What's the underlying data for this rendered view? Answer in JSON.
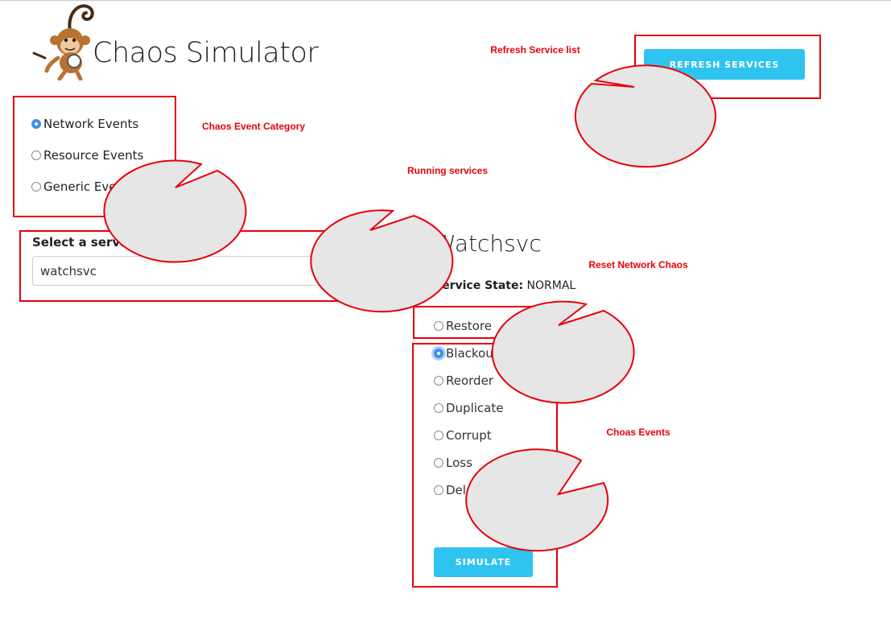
{
  "header": {
    "title": "Chaos Simulator"
  },
  "logo": {
    "icon": "monkey-logo-icon"
  },
  "refresh_button": {
    "label": "REFRESH SERVICES"
  },
  "categories": [
    {
      "label": "Network Events",
      "checked": true
    },
    {
      "label": "Resource Events",
      "checked": false
    },
    {
      "label": "Generic Events",
      "checked": false
    }
  ],
  "service_select": {
    "label": "Select a service",
    "value": "watchsvc"
  },
  "service": {
    "name": "Watchsvc",
    "state_label": "Service State:",
    "state_value": "NORMAL"
  },
  "restore": {
    "label": "Restore",
    "checked": false
  },
  "events": [
    {
      "label": "Blackout",
      "checked": true
    },
    {
      "label": "Reorder",
      "checked": false
    },
    {
      "label": "Duplicate",
      "checked": false
    },
    {
      "label": "Corrupt",
      "checked": false
    },
    {
      "label": "Loss",
      "checked": false
    },
    {
      "label": "Delay",
      "checked": false
    }
  ],
  "simulate_button": {
    "label": "SIMULATE"
  },
  "annotations": {
    "refresh": "Refresh Service list",
    "category": "Chaos Event Category",
    "running": "Running services",
    "reset": "Reset Network Chaos",
    "events": "Choas Events"
  },
  "colors": {
    "accent": "#2fc4ef",
    "annotation": "#e8000b",
    "radio_checked": "#3d8fe8",
    "bubble": "#e6e6e6"
  }
}
